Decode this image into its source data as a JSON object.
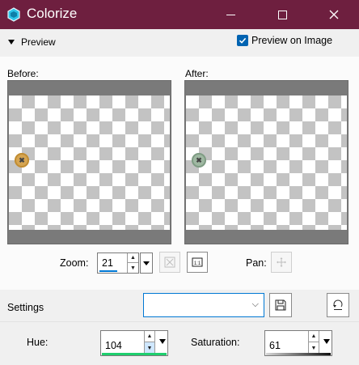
{
  "window": {
    "title": "Colorize",
    "minimize_icon": "minimize-icon",
    "maximize_icon": "maximize-icon",
    "close_icon": "close-icon"
  },
  "preview": {
    "toggle_label": "Preview",
    "preview_on_image_label": "Preview on Image",
    "preview_on_image_checked": true,
    "before_label": "Before:",
    "after_label": "After:"
  },
  "zoom": {
    "label": "Zoom:",
    "value": "21"
  },
  "pan": {
    "label": "Pan:"
  },
  "settings": {
    "label": "Settings",
    "preset_value": ""
  },
  "hue": {
    "label": "Hue:",
    "value": "104"
  },
  "saturation": {
    "label": "Saturation:",
    "value": "61"
  },
  "colors": {
    "titlebar": "#6e1f3f",
    "accent": "#0078d4",
    "checkbox": "#0063b1",
    "hue_bar": "#1ecf6e"
  }
}
